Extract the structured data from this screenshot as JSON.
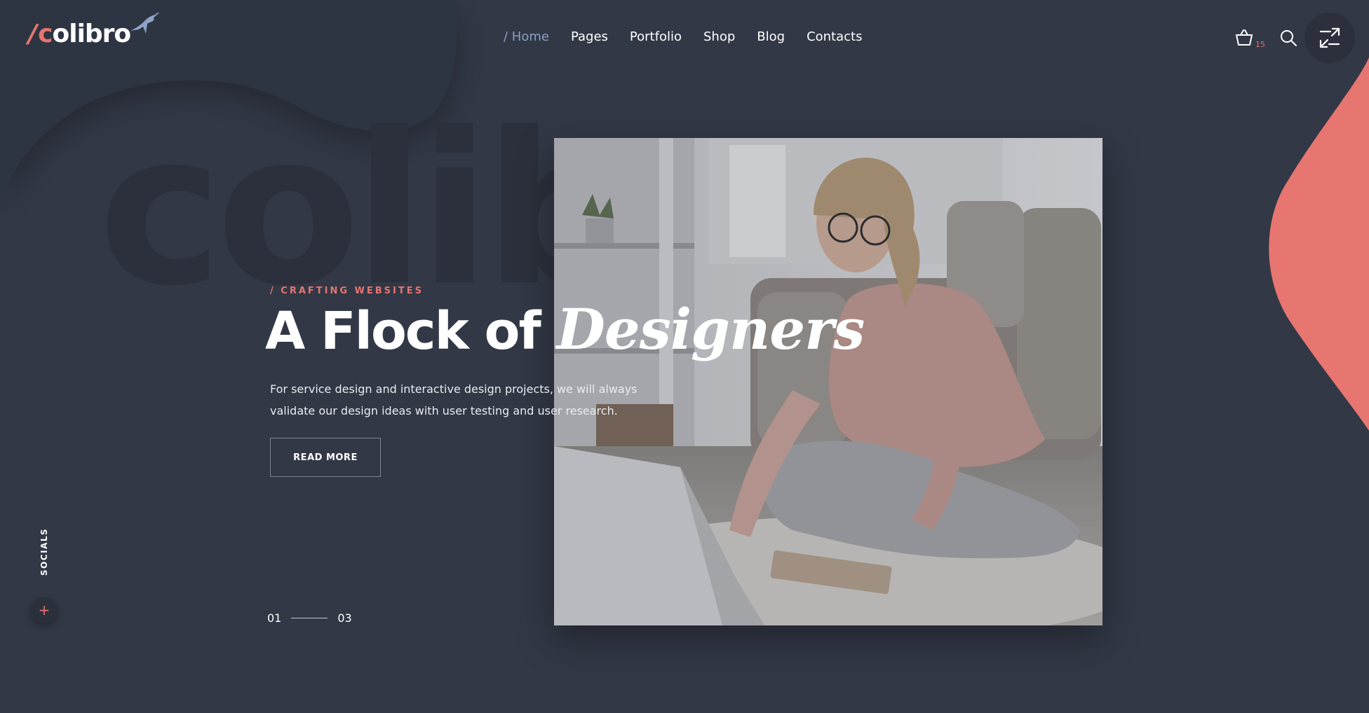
{
  "header": {
    "logo": {
      "slash": "/",
      "c": "c",
      "rest": "olibro"
    },
    "nav": [
      {
        "label": "/ Home",
        "active": true
      },
      {
        "label": "Pages"
      },
      {
        "label": "Portfolio"
      },
      {
        "label": "Shop"
      },
      {
        "label": "Blog"
      },
      {
        "label": "Contacts"
      }
    ],
    "cart_count": "15",
    "icons": [
      "basket-icon",
      "search-icon",
      "expand-icon"
    ]
  },
  "hero": {
    "ghost_word": "colibro",
    "eyebrow": "/ CRAFTING WEBSITES",
    "headline_plain": "A Flock of ",
    "headline_italic": "Designers",
    "description": "For service design and interactive design projects, we will always validate our design ideas with user testing and user research.",
    "button_label": "READ MORE",
    "pager_current": "01",
    "pager_total": "03"
  },
  "sidebar": {
    "socials_label": "SOCIALS",
    "socials_toggle": "+"
  },
  "colors": {
    "background": "#323846",
    "accent": "#e77570",
    "nav_active": "#8b9ec5"
  }
}
